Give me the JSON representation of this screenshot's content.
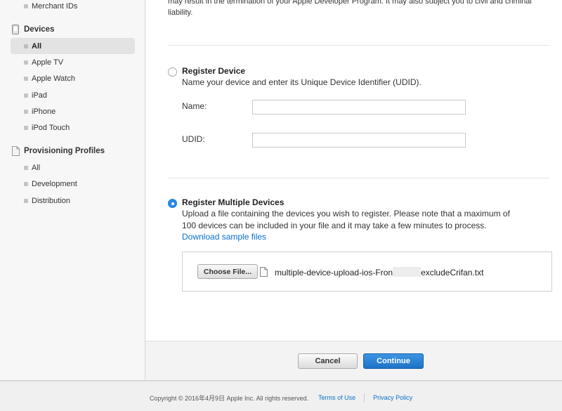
{
  "sidebar": {
    "top_item": {
      "label": "Merchant IDs"
    },
    "devices": {
      "heading": "Devices",
      "items": [
        {
          "label": "All",
          "active": true
        },
        {
          "label": "Apple TV"
        },
        {
          "label": "Apple Watch"
        },
        {
          "label": "iPad"
        },
        {
          "label": "iPhone"
        },
        {
          "label": "iPod Touch"
        }
      ]
    },
    "profiles": {
      "heading": "Provisioning Profiles",
      "items": [
        {
          "label": "All"
        },
        {
          "label": "Development"
        },
        {
          "label": "Distribution"
        }
      ]
    }
  },
  "main": {
    "top_text_line1": "may result in the termination of your Apple Developer Program. It may also subject you to civil and criminal",
    "top_text_line2": "liability.",
    "register_device": {
      "title": "Register Device",
      "description": "Name your device and enter its Unique Device Identifier (UDID).",
      "name_label": "Name:",
      "name_value": "",
      "udid_label": "UDID:",
      "udid_value": "",
      "selected": false
    },
    "register_multiple": {
      "title": "Register Multiple Devices",
      "description_line1": "Upload a file containing the devices you wish to register. Please note that a maximum of",
      "description_line2": "100 devices can be included in your file and it may take a few minutes to process.",
      "download_link": "Download sample files",
      "choose_file_label": "Choose File...",
      "file_name_prefix": "multiple-device-upload-ios-Fron",
      "file_name_suffix": "excludeCrifan.txt",
      "selected": true
    },
    "buttons": {
      "cancel": "Cancel",
      "continue": "Continue"
    }
  },
  "footer": {
    "copyright": "Copyright © 2016年4月9日 Apple Inc. All rights reserved.",
    "terms": "Terms of Use",
    "privacy": "Privacy Policy"
  },
  "colors": {
    "accent": "#0a6fcc",
    "primary_button": "#1d72c6",
    "sidebar_bg": "#f7f7f7"
  }
}
